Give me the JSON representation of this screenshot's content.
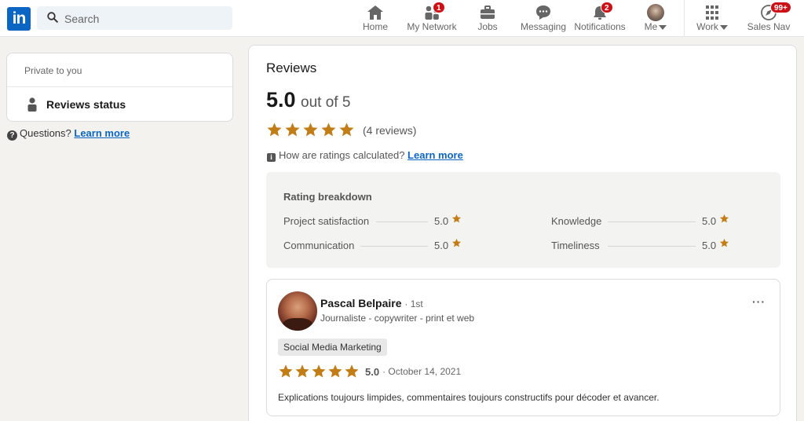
{
  "nav": {
    "search_placeholder": "Search",
    "items": [
      {
        "label": "Home",
        "icon": "home-icon"
      },
      {
        "label": "My Network",
        "icon": "network-icon",
        "badge": "1"
      },
      {
        "label": "Jobs",
        "icon": "briefcase-icon"
      },
      {
        "label": "Messaging",
        "icon": "message-icon"
      },
      {
        "label": "Notifications",
        "icon": "bell-icon",
        "badge": "2"
      },
      {
        "label": "Me",
        "icon": "avatar"
      },
      {
        "label": "Work",
        "icon": "grid-icon"
      },
      {
        "label": "Sales Nav",
        "icon": "compass-icon",
        "badge": "99+"
      }
    ],
    "brand_color": "#0a66c2",
    "badge_color": "#cc1016"
  },
  "sidebar": {
    "private_label": "Private to you",
    "status_label": "Reviews status",
    "questions_text": "Questions?",
    "learn_more": "Learn more"
  },
  "reviews": {
    "title": "Reviews",
    "score": "5.0",
    "out_of": "out of 5",
    "count": "(4 reviews)",
    "rating": 5,
    "how_calc": "How are ratings calculated?",
    "learn_more": "Learn more",
    "star_color": "#c37d16",
    "breakdown": {
      "title": "Rating breakdown",
      "items": [
        {
          "name": "Project satisfaction",
          "value": "5.0"
        },
        {
          "name": "Communication",
          "value": "5.0"
        },
        {
          "name": "Knowledge",
          "value": "5.0"
        },
        {
          "name": "Timeliness",
          "value": "5.0"
        }
      ]
    },
    "review": {
      "name": "Pascal Belpaire",
      "degree": "· 1st",
      "headline": "Journaliste - copywriter - print et web",
      "tag": "Social Media Marketing",
      "rating": 5,
      "value": "5.0",
      "date": "· October 14, 2021",
      "comment": "Explications toujours limpides, commentaires toujours constructifs pour décoder et avancer."
    }
  }
}
